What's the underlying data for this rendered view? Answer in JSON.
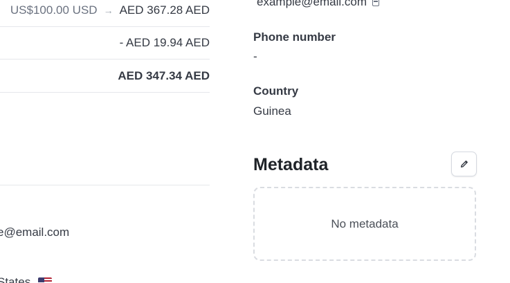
{
  "left_panel": {
    "conversion": {
      "from": "US$100.00 USD",
      "arrow": "→",
      "to": "AED 367.28 AED"
    },
    "fee": "- AED 19.94 AED",
    "net": "AED 347.34 AED",
    "email_partial": "e@email.com",
    "country_partial": "States",
    "country_flag_icon": "us-flag-icon"
  },
  "customer": {
    "email_partial": "example@email.com",
    "copy_icon": "copy-icon",
    "phone_label": "Phone number",
    "phone_value": "-",
    "country_label": "Country",
    "country_value": "Guinea"
  },
  "metadata": {
    "title": "Metadata",
    "edit_icon": "pencil-icon",
    "empty_text": "No metadata"
  }
}
